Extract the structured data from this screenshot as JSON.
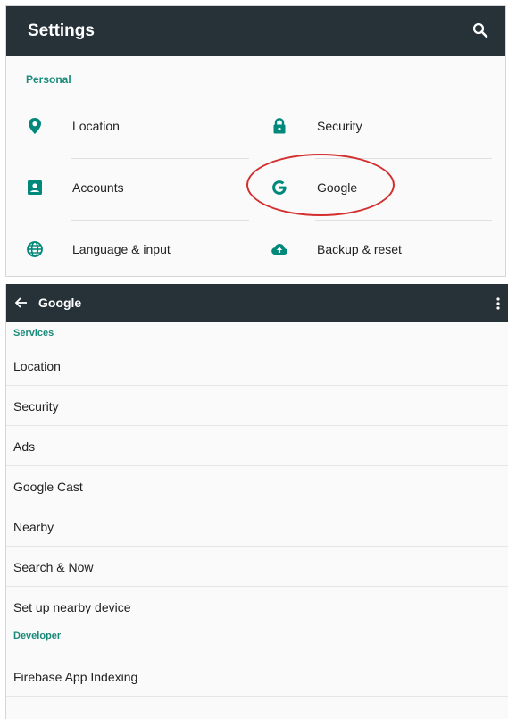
{
  "settings": {
    "title": "Settings",
    "section": "Personal",
    "items": [
      {
        "label": "Location",
        "icon": "location-pin-icon"
      },
      {
        "label": "Security",
        "icon": "lock-icon"
      },
      {
        "label": "Accounts",
        "icon": "account-box-icon"
      },
      {
        "label": "Google",
        "icon": "google-g-icon"
      },
      {
        "label": "Language & input",
        "icon": "globe-icon"
      },
      {
        "label": "Backup & reset",
        "icon": "cloud-upload-icon"
      }
    ],
    "highlight_color": "#d32f2f"
  },
  "google": {
    "title": "Google",
    "sections": [
      {
        "header": "Services",
        "items": [
          "Location",
          "Security",
          "Ads",
          "Google Cast",
          "Nearby",
          "Search & Now",
          "Set up nearby device"
        ]
      },
      {
        "header": "Developer",
        "items": [
          "Firebase App Indexing"
        ]
      }
    ]
  },
  "colors": {
    "toolbar": "#263238",
    "accent": "#1a8a7a",
    "icon": "#00897b"
  }
}
